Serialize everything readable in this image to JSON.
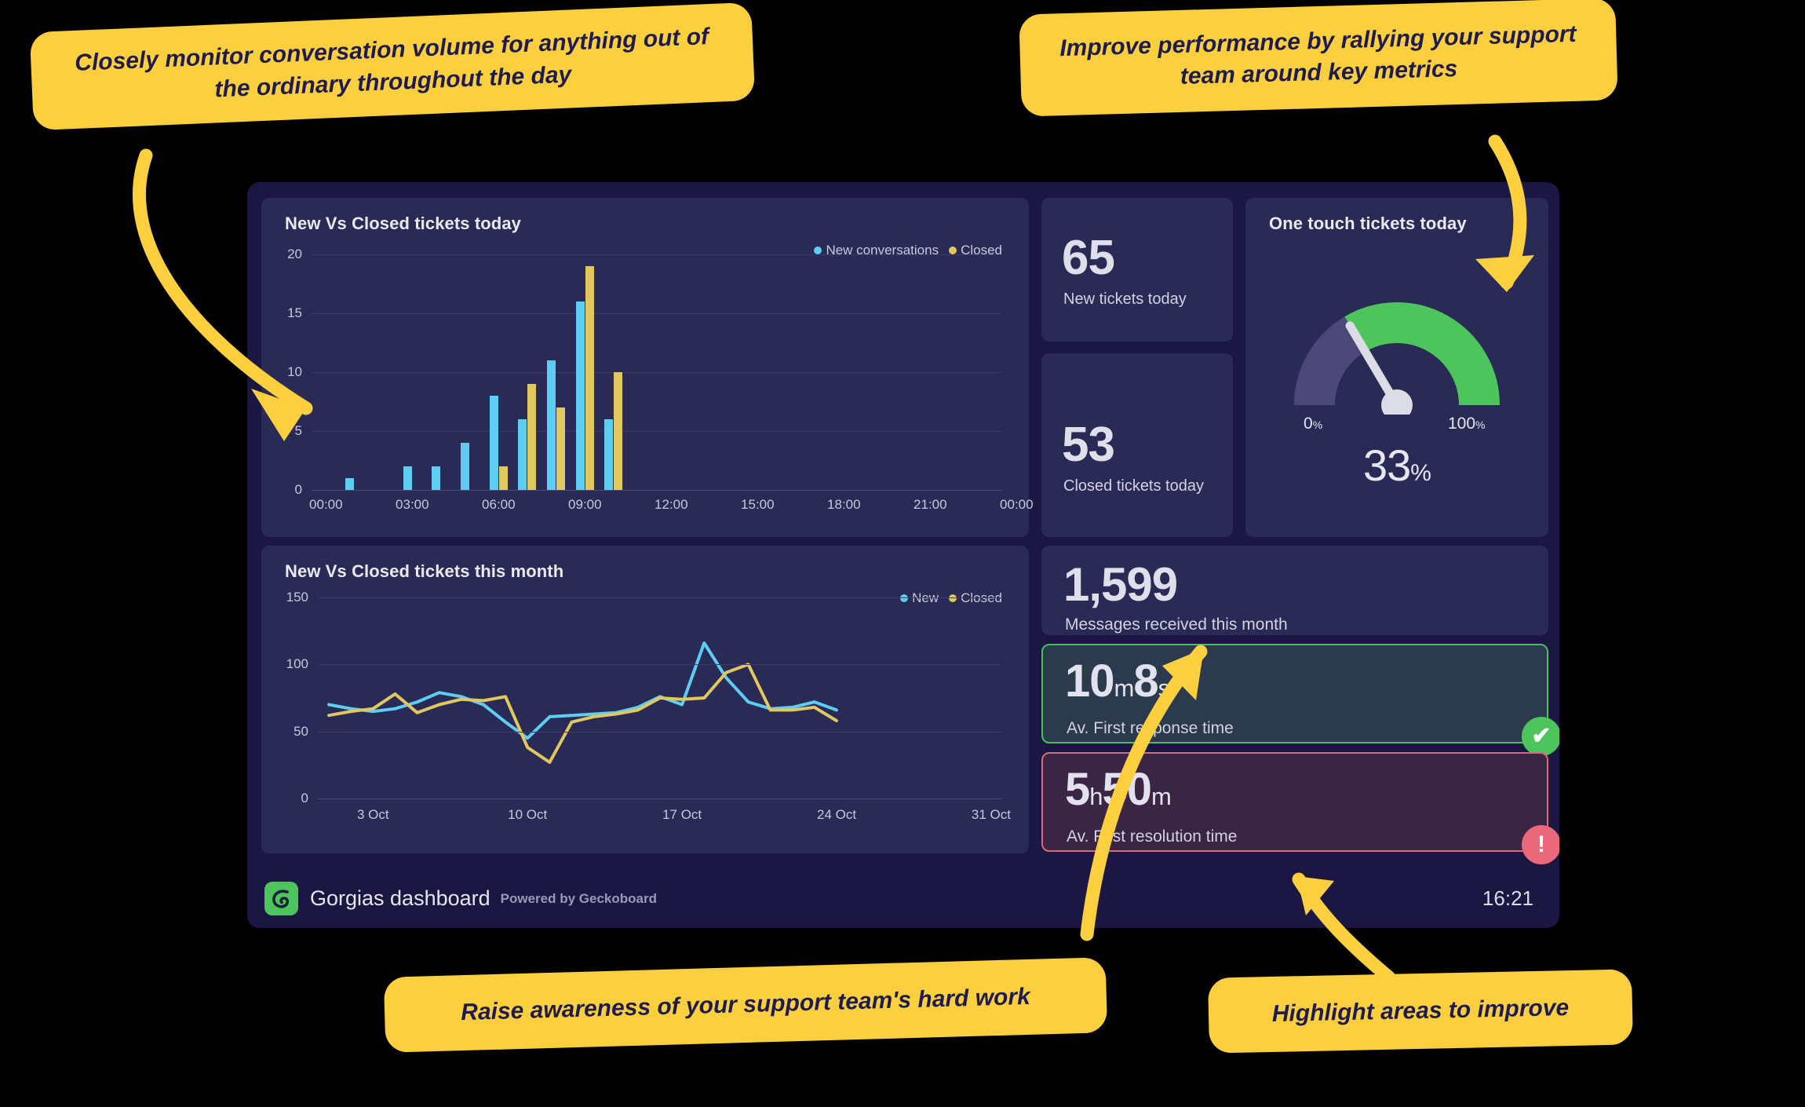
{
  "colors": {
    "page_background": "#000000",
    "dashboard_background": "#1b1642",
    "widget_background": "#2a2a56",
    "series_new": "#5ecdf2",
    "series_closed": "#e0c75e",
    "gauge_green": "#4ec45c",
    "gauge_track": "#4c4878",
    "status_ok": "#4ec45c",
    "status_warn": "#e9687a",
    "callout_yellow": "#fccf3f",
    "callout_text": "#1f1b4d",
    "brand_green": "#4ec45c"
  },
  "callouts": [
    {
      "id": "monitor-volume",
      "text": "Closely monitor conversation volume for anything out of the ordinary throughout the day"
    },
    {
      "id": "improve-performance",
      "text": "Improve performance by rallying your support team around key metrics"
    },
    {
      "id": "raise-awareness",
      "text": "Raise awareness of your support team's hard work"
    },
    {
      "id": "highlight-areas",
      "text": "Highlight areas to improve"
    }
  ],
  "widgets": {
    "bar_chart": {
      "title": "New Vs Closed tickets today"
    },
    "new_tickets": {
      "value": "65",
      "label": "New tickets today"
    },
    "closed_tickets": {
      "value": "53",
      "label": "Closed tickets today"
    },
    "gauge": {
      "title": "One touch tickets today",
      "min_label": "0",
      "min_unit": "%",
      "max_label": "100",
      "max_unit": "%",
      "value_label": "33",
      "value_unit": "%"
    },
    "line_chart": {
      "title": "New Vs Closed tickets this month"
    },
    "messages": {
      "value": "1,599",
      "label": "Messages received this month"
    },
    "first_response": {
      "value_main": "10",
      "unit_main": "m",
      "value_sec": "8",
      "unit_sec": "s",
      "label": "Av. First response time",
      "status": "ok",
      "status_glyph": "✔"
    },
    "first_resolution": {
      "value_main": "5",
      "unit_main": "h",
      "value_sec": "50",
      "unit_sec": "m",
      "label": "Av. First resolution time",
      "status": "warn",
      "status_glyph": "!"
    }
  },
  "footer": {
    "brand_name": "Gorgias dashboard",
    "powered_by": "Powered by Geckoboard",
    "clock": "16:21",
    "logo_icon": "gorgias-spiral-icon"
  },
  "chart_data": [
    {
      "id": "new-vs-closed-today",
      "type": "bar",
      "title": "New Vs Closed tickets today",
      "xlabel": "",
      "ylabel": "",
      "ylim": [
        0,
        20
      ],
      "yticks": [
        0,
        5,
        10,
        15,
        20
      ],
      "ytick_labels": [
        "0",
        "5",
        "10",
        "15",
        "20"
      ],
      "xticks": [
        "00:00",
        "03:00",
        "06:00",
        "09:00",
        "12:00",
        "15:00",
        "18:00",
        "21:00",
        "00:00"
      ],
      "grid": true,
      "legend": [
        "New conversations",
        "Closed"
      ],
      "legend_position": "top-right",
      "categories": [
        "00:00",
        "01:00",
        "02:00",
        "03:00",
        "04:00",
        "05:00",
        "06:00",
        "07:00",
        "08:00",
        "09:00",
        "10:00",
        "11:00",
        "12:00",
        "13:00",
        "14:00",
        "15:00",
        "16:00",
        "17:00",
        "18:00",
        "19:00",
        "20:00",
        "21:00",
        "22:00",
        "23:00"
      ],
      "series": [
        {
          "name": "New conversations",
          "color": "#5ecdf2",
          "values": [
            0,
            1,
            0,
            2,
            2,
            4,
            8,
            6,
            11,
            16,
            6,
            0,
            0,
            0,
            0,
            0,
            0,
            0,
            0,
            0,
            0,
            0,
            0,
            0
          ]
        },
        {
          "name": "Closed",
          "color": "#e0c75e",
          "values": [
            0,
            0,
            0,
            0,
            0,
            0,
            2,
            9,
            7,
            19,
            10,
            0,
            0,
            0,
            0,
            0,
            0,
            0,
            0,
            0,
            0,
            0,
            0,
            0
          ]
        }
      ]
    },
    {
      "id": "new-vs-closed-this-month",
      "type": "line",
      "title": "New Vs Closed tickets this month",
      "xlabel": "",
      "ylabel": "",
      "ylim": [
        0,
        150
      ],
      "yticks": [
        0,
        50,
        100,
        150
      ],
      "ytick_labels": [
        "0",
        "50",
        "100",
        "150"
      ],
      "xticks": [
        "3 Oct",
        "10 Oct",
        "17 Oct",
        "24 Oct",
        "31 Oct"
      ],
      "xtick_positions": [
        3,
        10,
        17,
        24,
        31
      ],
      "grid": true,
      "legend": [
        "New",
        "Closed"
      ],
      "legend_position": "top-right",
      "x": [
        1,
        2,
        3,
        4,
        5,
        6,
        7,
        8,
        9,
        10,
        11,
        12,
        13,
        14,
        15,
        16,
        17,
        18,
        19,
        20,
        21,
        22
      ],
      "series": [
        {
          "name": "New",
          "color": "#5ecdf2",
          "values": [
            70,
            67,
            65,
            67,
            72,
            79,
            76,
            70,
            57,
            45,
            61,
            62,
            63,
            64,
            68,
            76,
            70,
            116,
            90,
            72,
            67,
            68,
            72,
            66
          ]
        },
        {
          "name": "Closed",
          "color": "#e0c75e",
          "values": [
            62,
            65,
            67,
            78,
            64,
            70,
            74,
            73,
            76,
            38,
            27,
            57,
            61,
            63,
            66,
            75,
            74,
            75,
            94,
            100,
            66,
            66,
            68,
            58
          ]
        }
      ]
    },
    {
      "id": "one-touch-tickets-gauge",
      "type": "gauge",
      "title": "One touch tickets today",
      "value": 33,
      "min": 0,
      "max": 100,
      "unit": "%",
      "track_color": "#4c4878",
      "fill_color": "#4ec45c"
    }
  ]
}
